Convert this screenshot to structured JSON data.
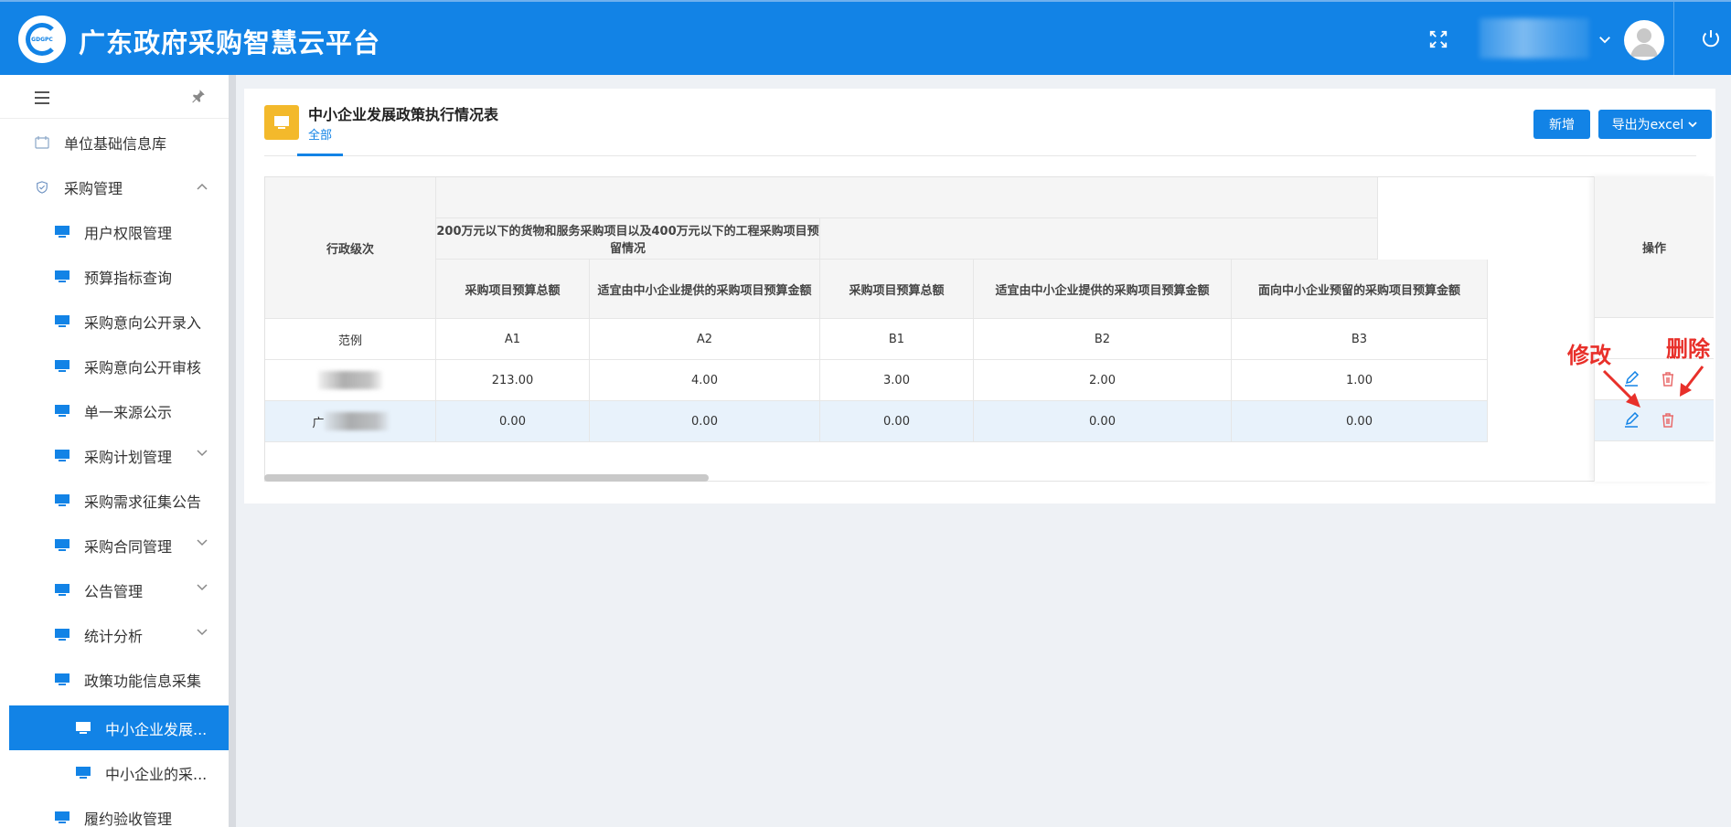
{
  "header": {
    "app_title": "广东政府采购智慧云平台",
    "logo_text": "GDGPC"
  },
  "sidebar": {
    "items": [
      {
        "label": "单位基础信息库",
        "icon": "calendar-icon"
      },
      {
        "label": "采购管理",
        "icon": "shield-icon",
        "expanded": true
      },
      {
        "label": "用户权限管理",
        "icon": "monitor-icon"
      },
      {
        "label": "预算指标查询",
        "icon": "monitor-icon"
      },
      {
        "label": "采购意向公开录入",
        "icon": "monitor-icon"
      },
      {
        "label": "采购意向公开审核",
        "icon": "monitor-icon"
      },
      {
        "label": "单一来源公示",
        "icon": "monitor-icon"
      },
      {
        "label": "采购计划管理",
        "icon": "monitor-icon"
      },
      {
        "label": "采购需求征集公告",
        "icon": "monitor-icon"
      },
      {
        "label": "采购合同管理",
        "icon": "monitor-icon"
      },
      {
        "label": "公告管理",
        "icon": "monitor-icon"
      },
      {
        "label": "统计分析",
        "icon": "monitor-icon"
      },
      {
        "label": "政策功能信息采集",
        "icon": "monitor-icon"
      },
      {
        "label": "中小企业发展...",
        "icon": "monitor-icon",
        "active": true
      },
      {
        "label": "中小企业的采...",
        "icon": "monitor-icon"
      },
      {
        "label": "履约验收管理",
        "icon": "monitor-icon"
      }
    ]
  },
  "page": {
    "title": "中小企业发展政策执行情况表",
    "subtitle": "全部",
    "add_button": "新增",
    "export_button": "导出为excel"
  },
  "table": {
    "group_header": "200万元以下的货物和服务采购项目以及400万元以下的工程采购项目预留情况",
    "col_level": "行政级次",
    "col_ops": "操作",
    "columns": [
      "采购项目预算总额",
      "适宜由中小企业提供的采购项目预算金额",
      "采购项目预算总额",
      "适宜由中小企业提供的采购项目预算金额",
      "面向中小企业预留的采购项目预算金额"
    ],
    "example_row": {
      "level": "范例",
      "values": [
        "A1",
        "A2",
        "B1",
        "B2",
        "B3"
      ]
    },
    "rows": [
      {
        "level": "",
        "values": [
          "213.00",
          "4.00",
          "3.00",
          "2.00",
          "1.00"
        ]
      },
      {
        "level": "广",
        "values": [
          "0.00",
          "0.00",
          "0.00",
          "0.00",
          "0.00"
        ]
      }
    ]
  },
  "annotations": {
    "edit_label": "修改",
    "delete_label": "删除"
  },
  "colors": {
    "primary": "#1283e6",
    "title_icon": "#f3b92b",
    "annotation": "#e8302a",
    "delete": "#e86a6a"
  }
}
